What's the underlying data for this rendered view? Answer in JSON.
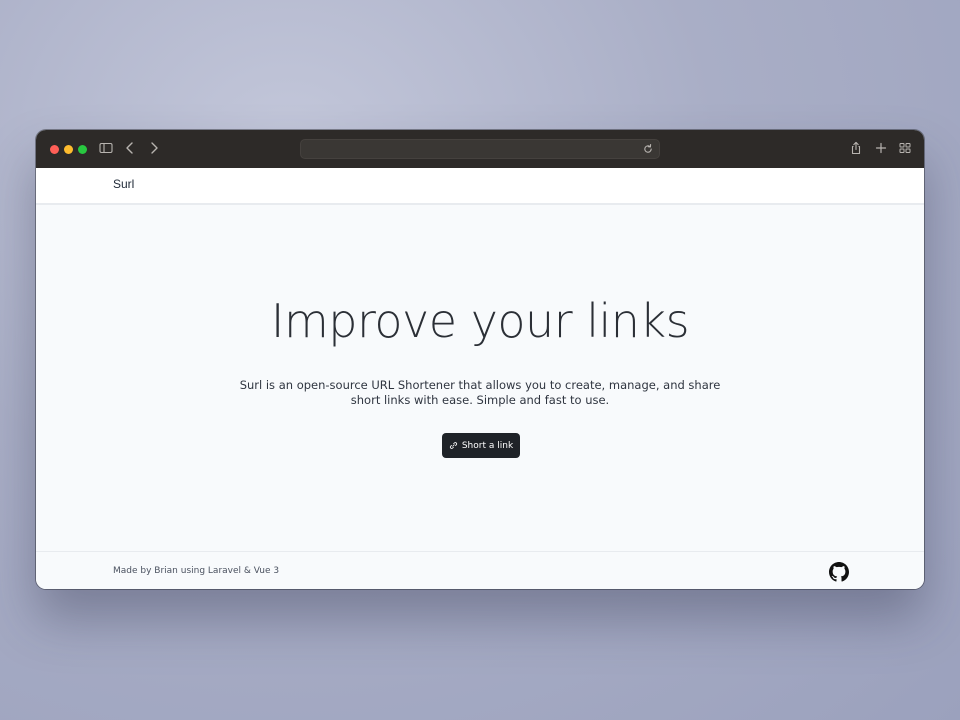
{
  "browser": {
    "address_value": "",
    "icons": [
      "sidebar-icon",
      "back-icon",
      "forward-icon",
      "reload-icon",
      "share-icon",
      "new-tab-icon",
      "tab-overview-icon"
    ],
    "traffic_lights": [
      "#ff5f57",
      "#febc2e",
      "#28c840"
    ]
  },
  "navbar": {
    "brand": "Surl"
  },
  "hero": {
    "title": "Improve your links",
    "description": "Surl is an open-source URL Shortener that allows you to create, manage, and share short links with ease. Simple and fast to use.",
    "button_label": "Short a link",
    "button_icon": "link-icon"
  },
  "footer": {
    "credit": "Made by Brian using Laravel & Vue 3",
    "icon": "github-icon"
  },
  "colors": {
    "titlebar": "#2d2a28",
    "page_background": "#f8fafc",
    "button": "#1f2328"
  }
}
